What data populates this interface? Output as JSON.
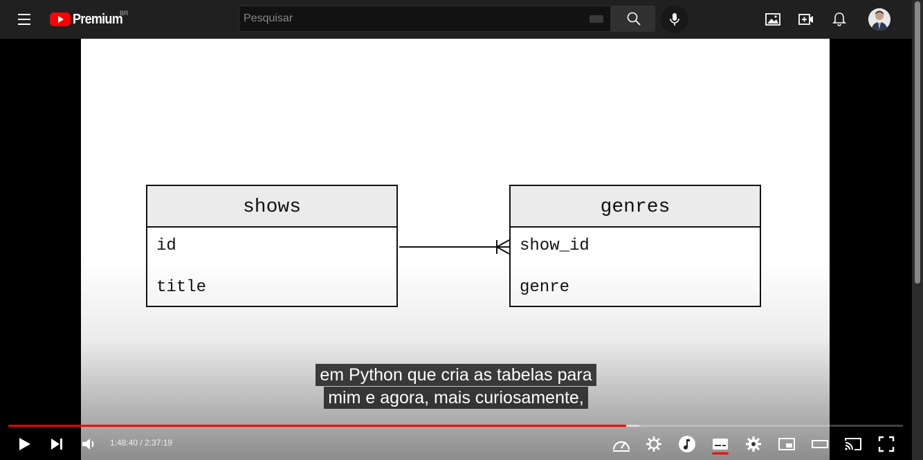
{
  "topbar": {
    "logo_text": "Premium",
    "country_code": "BR",
    "search_placeholder": "Pesquisar",
    "icons": [
      "menu-icon",
      "youtube-logo-icon",
      "keyboard-icon",
      "search-icon",
      "mic-icon",
      "image-icon",
      "create-icon",
      "notifications-icon",
      "avatar"
    ]
  },
  "slide": {
    "left_table": {
      "title": "shows",
      "fields": [
        "id",
        "title"
      ]
    },
    "right_table": {
      "title": "genres",
      "fields": [
        "show_id",
        "genre"
      ]
    },
    "relationship": "one-to-many"
  },
  "captions": {
    "line1": "em Python que cria as tabelas para",
    "line2": "mim e agora, mais curiosamente,"
  },
  "player": {
    "current_time": "1:48:40",
    "separator": " / ",
    "duration": "2:37:19",
    "time_display": "1:48:40 / 2:37:19",
    "played_fraction": 0.691,
    "buffered_fraction": 0.705,
    "accent_color": "#ff0000",
    "icons": [
      "play-icon",
      "next-icon",
      "volume-icon",
      "playback-speed-icon",
      "quality-icon",
      "music-icon",
      "subtitles-icon",
      "settings-icon",
      "miniplayer-icon",
      "theater-mode-icon",
      "cast-icon",
      "fullscreen-icon"
    ]
  }
}
